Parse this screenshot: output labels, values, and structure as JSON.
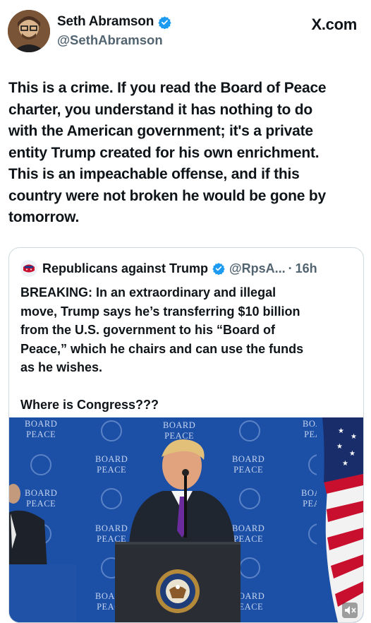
{
  "post": {
    "author_name": "Seth Abramson",
    "author_handle": "@SethAbramson",
    "source_label": "X.com",
    "text": "This is a crime. If you read the Board of Peace\ncharter, you understand it has nothing to do\nwith the American government; it's a private\nentity Trump created for his own enrichment.\nThis is an impeachable offense, and if this\ncountry were not broken he would be gone by\ntomorrow."
  },
  "quoted_post": {
    "author_name": "Republicans against Trump",
    "author_handle": "@RpsA...",
    "separator": "·",
    "timestamp": "16h",
    "text": "BREAKING: In an extraordinary and illegal\nmove, Trump says he’s transferring $10 billion\nfrom the U.S. government to his “Board of\nPeace,” which he chairs and can use the funds\nas he wishes.\n\nWhere is Congress???"
  },
  "media": {
    "backdrop_label_line1": "BOARD",
    "backdrop_label_line2": "PEACE",
    "mute_icon": "speaker-mute-icon"
  },
  "colors": {
    "verified_blue": "#1d9bf0",
    "secondary_text": "#536471",
    "backdrop_blue": "#1c4fa6"
  }
}
